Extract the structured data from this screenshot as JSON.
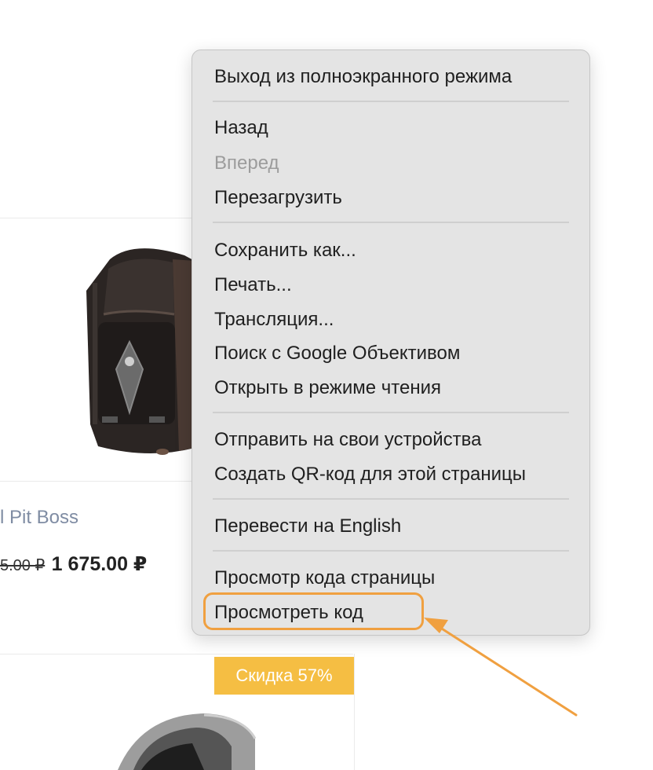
{
  "context_menu": {
    "items": [
      {
        "label": "Выход из полноэкранного режима",
        "enabled": true
      },
      {
        "label": "Назад",
        "enabled": true
      },
      {
        "label": "Вперед",
        "enabled": false
      },
      {
        "label": "Перезагрузить",
        "enabled": true
      },
      {
        "label": "Сохранить как...",
        "enabled": true
      },
      {
        "label": "Печать...",
        "enabled": true
      },
      {
        "label": "Трансляция...",
        "enabled": true
      },
      {
        "label": "Поиск с Google Объективом",
        "enabled": true
      },
      {
        "label": "Открыть в режиме чтения",
        "enabled": true
      },
      {
        "label": "Отправить на свои устройства",
        "enabled": true
      },
      {
        "label": "Создать QR-код для этой страницы",
        "enabled": true
      },
      {
        "label": "Перевести на English",
        "enabled": true
      },
      {
        "label": "Просмотр кода страницы",
        "enabled": true
      },
      {
        "label": "Просмотреть код",
        "enabled": true,
        "highlighted": true
      }
    ]
  },
  "product": {
    "name": "l Pit Boss",
    "old_price": "5.00 ₽",
    "new_price": "1 675.00 ₽",
    "image": "backpack"
  },
  "next_product": {
    "badge": "Скидка 57%",
    "image": "device"
  },
  "colors": {
    "highlight": "#f0a040",
    "badge": "#f5be43",
    "product_name": "#7f8ca3"
  }
}
